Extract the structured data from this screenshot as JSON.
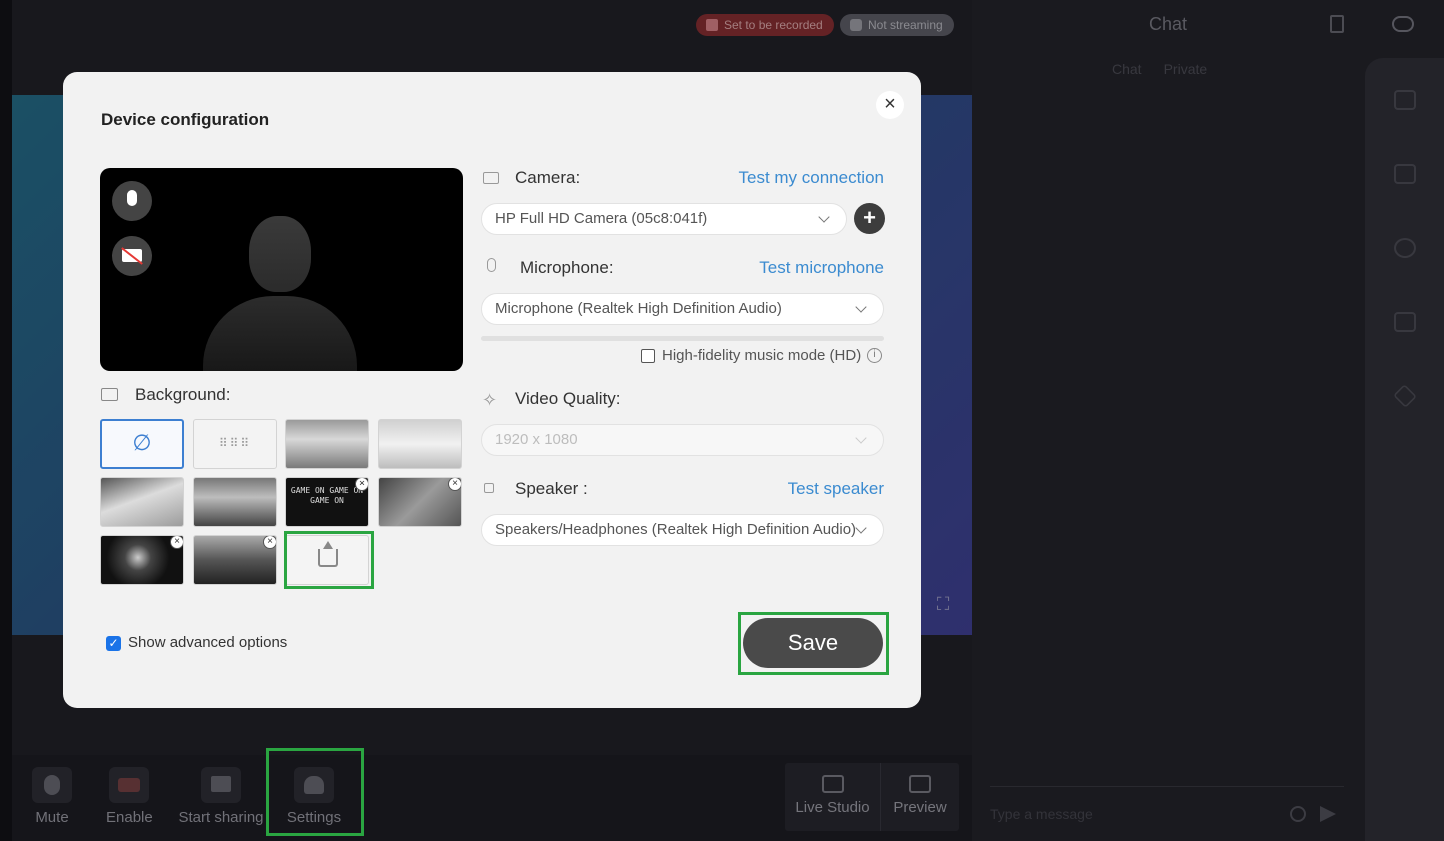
{
  "top_badges": {
    "recording": "Set to be recorded",
    "streaming": "Not streaming"
  },
  "toolbar": {
    "mute": "Mute",
    "enable": "Enable",
    "share": "Start sharing",
    "settings": "Settings",
    "live_studio": "Live Studio",
    "preview": "Preview"
  },
  "chat": {
    "title": "Chat",
    "tabs": [
      "Chat",
      "Private"
    ],
    "placeholder": "Type a message"
  },
  "modal": {
    "title": "Device configuration",
    "close": "×",
    "background_label": "Background:",
    "backgrounds": [
      {
        "name": "none",
        "glyph": "∅"
      },
      {
        "name": "blur",
        "glyph": "⠿⠿⠿"
      },
      {
        "name": "room"
      },
      {
        "name": "office"
      },
      {
        "name": "beach"
      },
      {
        "name": "window"
      },
      {
        "name": "game-on",
        "text": "GAME ON GAME ON GAME ON",
        "removable": true
      },
      {
        "name": "gray",
        "removable": true
      },
      {
        "name": "dark-figure",
        "removable": true
      },
      {
        "name": "dark-street",
        "removable": true
      },
      {
        "name": "upload"
      }
    ],
    "advanced_label": "Show advanced options",
    "advanced_checked": true,
    "camera": {
      "label": "Camera:",
      "link": "Test my connection",
      "value": "HP Full HD Camera (05c8:041f)",
      "add": "+"
    },
    "microphone": {
      "label": "Microphone:",
      "link": "Test microphone",
      "value": "Microphone (Realtek High Definition Audio)"
    },
    "hd_mode": {
      "label": "High-fidelity music mode (HD)",
      "checked": false,
      "info": "i"
    },
    "video_quality": {
      "label": "Video Quality:",
      "value": "1920 x 1080"
    },
    "speaker": {
      "label": "Speaker :",
      "link": "Test speaker",
      "value": "Speakers/Headphones (Realtek High Definition Audio)"
    },
    "save": "Save"
  },
  "colors": {
    "accent_link": "#3b8bd0",
    "highlight": "#2aa541",
    "save_bg": "#4a4a4a"
  }
}
